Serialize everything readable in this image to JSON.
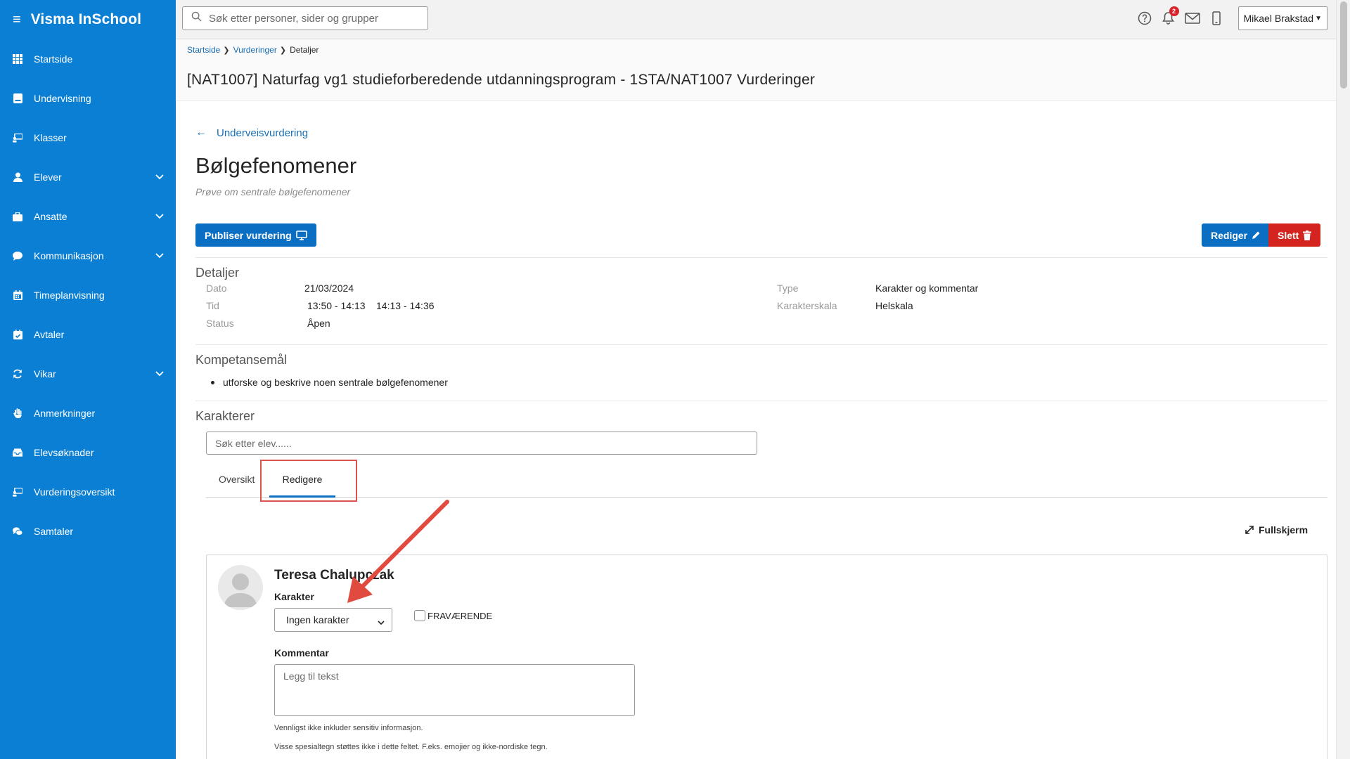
{
  "app": {
    "title": "Visma InSchool"
  },
  "sidebar": {
    "items": [
      {
        "label": "Startside",
        "icon": "grid-icon",
        "expandable": false
      },
      {
        "label": "Undervisning",
        "icon": "book-icon",
        "expandable": false
      },
      {
        "label": "Klasser",
        "icon": "classroom-icon",
        "expandable": false
      },
      {
        "label": "Elever",
        "icon": "student-icon",
        "expandable": true
      },
      {
        "label": "Ansatte",
        "icon": "briefcase-icon",
        "expandable": true
      },
      {
        "label": "Kommunikasjon",
        "icon": "chat-bubble-icon",
        "expandable": true
      },
      {
        "label": "Timeplanvisning",
        "icon": "calendar-icon",
        "expandable": false
      },
      {
        "label": "Avtaler",
        "icon": "calendar-check-icon",
        "expandable": false
      },
      {
        "label": "Vikar",
        "icon": "refresh-icon",
        "expandable": true
      },
      {
        "label": "Anmerkninger",
        "icon": "hand-icon",
        "expandable": false
      },
      {
        "label": "Elevsøknader",
        "icon": "inbox-icon",
        "expandable": false
      },
      {
        "label": "Vurderingsoversikt",
        "icon": "assessment-icon",
        "expandable": false
      },
      {
        "label": "Samtaler",
        "icon": "conversation-icon",
        "expandable": false
      }
    ]
  },
  "topbar": {
    "search_placeholder": "Søk etter personer, sider og grupper",
    "notification_count": "2",
    "user_name": "Mikael Brakstad"
  },
  "breadcrumb": {
    "home": "Startside",
    "assessments": "Vurderinger",
    "current": "Detaljer"
  },
  "page": {
    "title": "[NAT1007] Naturfag vg1 studieforberedende utdanningsprogram - 1STA/NAT1007 Vurderinger"
  },
  "assessment": {
    "back_label": "Underveisvurdering",
    "title": "Bølgefenomener",
    "subtitle": "Prøve om sentrale bølgefenomener",
    "publish_label": "Publiser vurdering",
    "edit_label": "Rediger",
    "delete_label": "Slett"
  },
  "details": {
    "heading": "Detaljer",
    "date_label": "Dato",
    "date_value": "21/03/2024",
    "time_label": "Tid",
    "time_value_1": "13:50 - 14:13",
    "time_value_2": "14:13 - 14:36",
    "status_label": "Status",
    "status_value": "Åpen",
    "type_label": "Type",
    "type_value": "Karakter og kommentar",
    "scale_label": "Karakterskala",
    "scale_value": "Helskala"
  },
  "competence": {
    "heading": "Kompetansemål",
    "goals": [
      "utforske og beskrive noen sentrale bølgefenomener"
    ]
  },
  "grades": {
    "heading": "Karakterer",
    "search_placeholder": "Søk etter elev......",
    "tab_overview": "Oversikt",
    "tab_edit": "Redigere",
    "fullscreen_label": "Fullskjerm"
  },
  "student": {
    "name": "Teresa Chalupczak",
    "grade_label": "Karakter",
    "grade_value": "Ingen karakter",
    "absent_label": "FRAVÆRENDE",
    "comment_label": "Kommentar",
    "comment_placeholder": "Legg til tekst",
    "hint_1": "Vennligst ikke inkluder sensitiv informasjon.",
    "hint_2": "Visse spesialtegn støttes ikke i dette feltet. F.eks. emojier og ikke-nordiske tegn."
  },
  "colors": {
    "sidebar": "#0a7fd4",
    "primary": "#0a6fc2",
    "danger": "#d3241f",
    "annotation": "#e04a3f"
  }
}
